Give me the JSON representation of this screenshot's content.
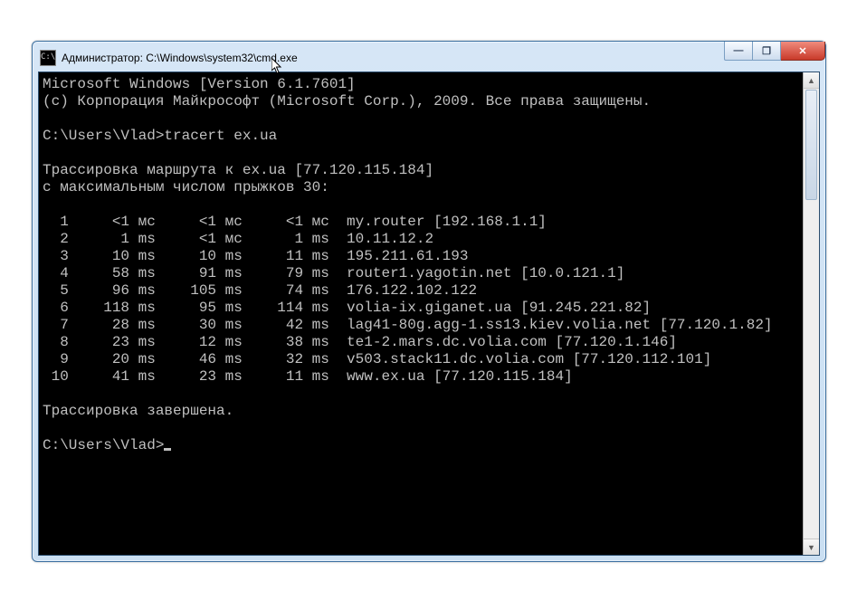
{
  "titlebar": {
    "title": "Администратор: C:\\Windows\\system32\\cmd.exe",
    "icon_label": "C:\\"
  },
  "buttons": {
    "min": "—",
    "max": "❐",
    "close": "✕"
  },
  "scrollbar": {
    "up": "▲",
    "down": "▼"
  },
  "banner": {
    "line1": "Microsoft Windows [Version 6.1.7601]",
    "line2": "(c) Корпорация Майкрософт (Microsoft Corp.), 2009. Все права защищены."
  },
  "prompt1": "C:\\Users\\Vlad>",
  "command1": "tracert ex.ua",
  "trace_header1": "Трассировка маршрута к ex.ua [77.120.115.184]",
  "trace_header2": "с максимальным числом прыжков 30:",
  "hops": [
    {
      "n": "1",
      "t1": "<1 мс",
      "t2": "<1 мс",
      "t3": "<1 мс",
      "host": "my.router [192.168.1.1]"
    },
    {
      "n": "2",
      "t1": "1 ms",
      "t2": "<1 мс",
      "t3": "1 ms",
      "host": "10.11.12.2"
    },
    {
      "n": "3",
      "t1": "10 ms",
      "t2": "10 ms",
      "t3": "11 ms",
      "host": "195.211.61.193"
    },
    {
      "n": "4",
      "t1": "58 ms",
      "t2": "91 ms",
      "t3": "79 ms",
      "host": "router1.yagotin.net [10.0.121.1]"
    },
    {
      "n": "5",
      "t1": "96 ms",
      "t2": "105 ms",
      "t3": "74 ms",
      "host": "176.122.102.122"
    },
    {
      "n": "6",
      "t1": "118 ms",
      "t2": "95 ms",
      "t3": "114 ms",
      "host": "volia-ix.giganet.ua [91.245.221.82]"
    },
    {
      "n": "7",
      "t1": "28 ms",
      "t2": "30 ms",
      "t3": "42 ms",
      "host": "lag41-80g.agg-1.ss13.kiev.volia.net [77.120.1.82]"
    },
    {
      "n": "8",
      "t1": "23 ms",
      "t2": "12 ms",
      "t3": "38 ms",
      "host": "te1-2.mars.dc.volia.com [77.120.1.146]"
    },
    {
      "n": "9",
      "t1": "20 ms",
      "t2": "46 ms",
      "t3": "32 ms",
      "host": "v503.stack11.dc.volia.com [77.120.112.101]"
    },
    {
      "n": "10",
      "t1": "41 ms",
      "t2": "23 ms",
      "t3": "11 ms",
      "host": "www.ex.ua [77.120.115.184]"
    }
  ],
  "trace_done": "Трассировка завершена.",
  "prompt2": "C:\\Users\\Vlad>"
}
